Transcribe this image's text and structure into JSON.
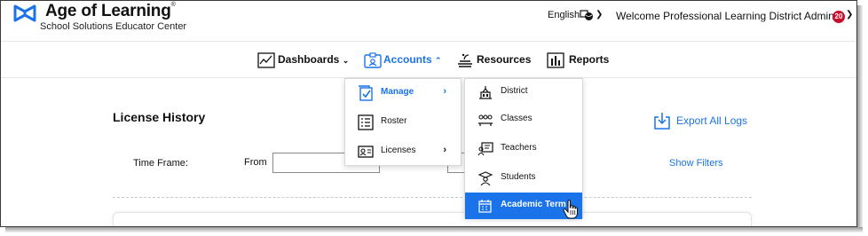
{
  "header": {
    "logo_title": "Age of Learning",
    "logo_trademark": "®",
    "logo_subtitle": "School Solutions Educator Center",
    "language": "English",
    "welcome": "Welcome Professional Learning District Admin!",
    "notification_count": "20"
  },
  "nav": {
    "dashboards": "Dashboards",
    "accounts": "Accounts",
    "resources": "Resources",
    "reports": "Reports"
  },
  "page": {
    "title": "License History",
    "export_label": "Export All Logs",
    "time_frame_label": "Time Frame:",
    "from_label": "From",
    "from_value": "",
    "show_filters": "Show Filters"
  },
  "accounts_menu": {
    "items": [
      {
        "label": "Manage",
        "icon": "manage-icon",
        "has_submenu": true,
        "active": true
      },
      {
        "label": "Roster",
        "icon": "roster-icon",
        "has_submenu": false
      },
      {
        "label": "Licenses",
        "icon": "licenses-icon",
        "has_submenu": true
      }
    ]
  },
  "manage_submenu": {
    "items": [
      {
        "label": "District",
        "icon": "district-icon"
      },
      {
        "label": "Classes",
        "icon": "classes-icon"
      },
      {
        "label": "Teachers",
        "icon": "teachers-icon"
      },
      {
        "label": "Students",
        "icon": "students-icon"
      },
      {
        "label": "Academic Term",
        "icon": "calendar-icon",
        "highlighted": true
      }
    ]
  },
  "colors": {
    "accent": "#1a73e8",
    "badge": "#c8102e",
    "logo_blue": "#1a73e8"
  }
}
